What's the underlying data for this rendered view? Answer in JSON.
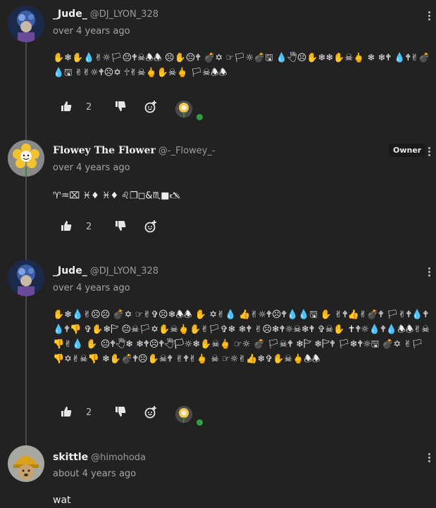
{
  "comments": [
    {
      "author": "_Jude_",
      "handle": "@DJ_LYON_328",
      "time": "over 4 years ago",
      "text": "✋❄✋💧✌☼🏳😐🕈☠🕭🕭 ☹✋😐🕈 💣✡ ☞🏳☼💣🖫 💧🖑☹✋❄❄✋☠🖕 ❄ ❄🕈 💧🕈✌💣💧🖫 ✌✌☼🕈☹✡ 🕆✌☠🖕✋☠🖕 🏳☠🕭🕭",
      "likes": "2",
      "avatar": "jude"
    },
    {
      "author": "Flowey The Flower",
      "handle": "@-_Flowey_-",
      "time": "over 4 years ago",
      "badge": "Owner",
      "text": "♈♒⌧ ♓♦ ♓♦ ♌❐◻&♏■🖎",
      "likes": "2",
      "avatar": "flowey"
    },
    {
      "author": "_Jude_",
      "handle": "@DJ_LYON_328",
      "time": "over 4 years ago",
      "text": "✋❄💧✌☹☹ 💣✡ ☞✌✞☹❄🕭🕭 ✋ ✡✌💧 👍✌☼🕈☹🕈💧💧🖫 ✋ ✌🕈👍✌💣🕈 🏳✌🕈💧🕈💧🕈👎 ✞✋❄🏱 😐☠🏳✡✋☠🖕✋✌🏳✞❄ ❄🕈 ✌☹❄🕈☼☠❄🕈 ✞☠✋ ✝🕈☼💧🕈💧🕭🕭✌☠👎✌💧 ✋ 😐🕈🖑❄ ❄🕈☹🕈🖑🏳☼❄✋☠🖕 ☞☼ 💣 🏳☠🕈 ❄🏱 ❄🏱🕈 🏳❄🕈☼🖫 💣✡ ✌🏳👎✡✌☠👎 ❄✋💣🕈☹✋☠🕈 ✌🕈✌🖕 ☠ ☞☼✌👍❄✞✋☠🖕🕭🕭",
      "likes": "2",
      "avatar": "jude"
    },
    {
      "author": "skittle",
      "handle": "@himohoda",
      "time": "about 4 years ago",
      "text": "wat",
      "avatar": "skittle"
    }
  ],
  "colors": {
    "background": "#222222",
    "online": "#2ea043",
    "thread": "#4a4a4a"
  },
  "icons": {
    "like": "thumbs-up-icon",
    "dislike": "thumbs-down-icon",
    "react": "add-reaction-icon",
    "menu": "kebab-menu-icon"
  }
}
